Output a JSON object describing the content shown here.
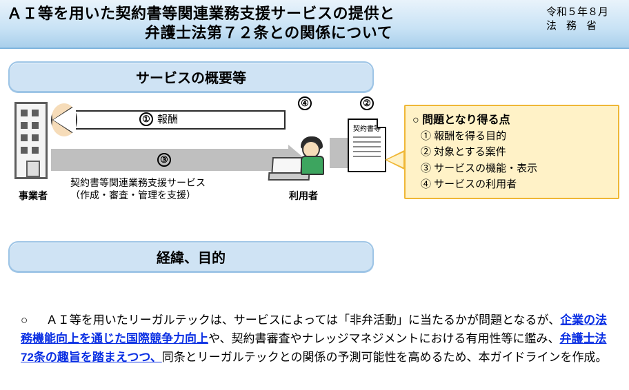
{
  "header": {
    "title_line1": "ＡＩ等を用いた契約書等関連業務支援サービスの提供と",
    "title_line2": "弁護士法第７２条との関係について",
    "date": "令和５年８月",
    "agency": "法務省"
  },
  "sections": {
    "overview": "サービスの概要等",
    "background": "経緯、目的"
  },
  "diagram": {
    "provider": "事業者",
    "user": "利用者",
    "arrow1": {
      "num": "①",
      "label": "報酬"
    },
    "arrow3": {
      "num": "③"
    },
    "service_line1": "契約書等関連業務支援サービス",
    "service_line2": "（作成・審査・管理を支援）",
    "marker2": "②",
    "marker4": "④",
    "doc_title": "契約書等"
  },
  "issues": {
    "title": "○ 問題となり得る点",
    "items": [
      "① 報酬を得る目的",
      "② 対象とする案件",
      "③ サービスの機能・表示",
      "④ サービスの利用者"
    ]
  },
  "body": {
    "bullet": "○",
    "t1": "ＡＩ等を用いたリーガルテックは、サービスによっては「非弁活動」に当たるかが問題となるが、",
    "u1": "企業の法務機能向上を通じた国際競争力向上",
    "t2": "や、契約書審査やナレッジマネジメントにおける有用性等に鑑み、",
    "u2": "弁護士法72条の趣旨を踏まえつつ、",
    "t3": "同条とリーガルテックとの関係の予測可能性を高めるため、本ガイドラインを作成。"
  }
}
